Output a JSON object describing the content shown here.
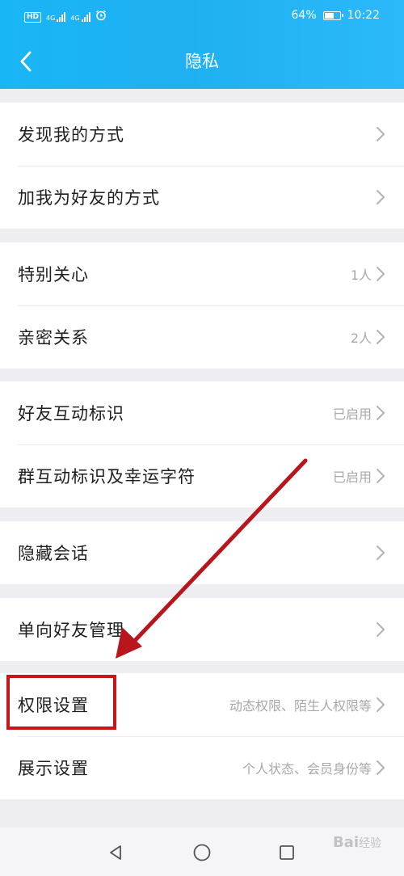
{
  "status_bar": {
    "network_badge": "HD",
    "sim1_label": "4G",
    "sim2_label": "4G",
    "battery_percent": "64%",
    "battery_level": 0.64,
    "time": "10:22"
  },
  "header": {
    "title": "隐私",
    "background_color": "#1fb0f2"
  },
  "groups": [
    {
      "rows": [
        {
          "label": "发现我的方式",
          "value": ""
        },
        {
          "label": "加我为好友的方式",
          "value": ""
        }
      ]
    },
    {
      "rows": [
        {
          "label": "特别关心",
          "value": "1人"
        },
        {
          "label": "亲密关系",
          "value": "2人"
        }
      ]
    },
    {
      "rows": [
        {
          "label": "好友互动标识",
          "value": "已启用"
        },
        {
          "label": "群互动标识及幸运字符",
          "value": "已启用"
        }
      ]
    },
    {
      "rows": [
        {
          "label": "隐藏会话",
          "value": ""
        }
      ]
    },
    {
      "rows": [
        {
          "label": "单向好友管理",
          "value": ""
        }
      ]
    },
    {
      "rows": [
        {
          "label": "权限设置",
          "value": "动态权限、陌生人权限等"
        },
        {
          "label": "展示设置",
          "value": "个人状态、会员身份等"
        }
      ]
    }
  ],
  "annotation": {
    "highlight_color": "#c8151b",
    "arrow_color": "#b8161c"
  },
  "nav_bar": {
    "back_icon": "triangle-back-icon",
    "home_icon": "circle-home-icon",
    "recents_icon": "square-recents-icon"
  },
  "watermark": {
    "text": "Bai",
    "suffix": "经验"
  }
}
